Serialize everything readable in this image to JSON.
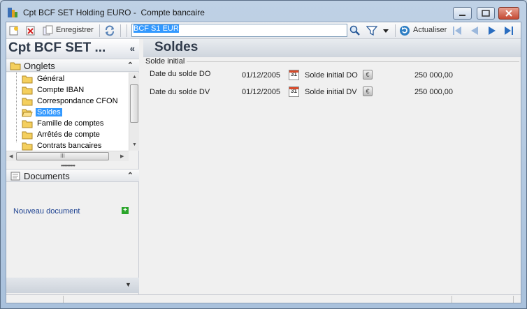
{
  "window": {
    "title": "Cpt BCF SET Holding EURO -  Compte bancaire"
  },
  "toolbar": {
    "save_label": "Enregistrer",
    "search_value": "BCF S1 EUR",
    "refresh_label": "Actualiser"
  },
  "left": {
    "entity_title": "Cpt BCF SET ...",
    "tabs_header": "Onglets",
    "tree_items": [
      {
        "label": "Général"
      },
      {
        "label": "Compte IBAN"
      },
      {
        "label": "Correspondance CFON"
      },
      {
        "label": "Soldes"
      },
      {
        "label": "Famille de comptes"
      },
      {
        "label": "Arrêtés de compte"
      },
      {
        "label": "Contrats bancaires"
      }
    ],
    "hscroll_grip": "III",
    "documents_header": "Documents",
    "new_document_link": "Nouveau document"
  },
  "main": {
    "page_title": "Soldes",
    "group_label": "Solde initial",
    "rows": [
      {
        "date_label": "Date du solde DO",
        "date_value": "01/12/2005",
        "amount_label": "Solde initial DO",
        "amount_value": "250 000,00"
      },
      {
        "date_label": "Date du solde DV",
        "date_value": "01/12/2005",
        "amount_label": "Solde initial DV",
        "amount_value": "250 000,00"
      }
    ],
    "calendar_glyph": "31",
    "currency_glyph": "€"
  },
  "colors": {
    "accent": "#3399ff",
    "title_text": "#2f3a4a",
    "link": "#1a3f8f"
  }
}
